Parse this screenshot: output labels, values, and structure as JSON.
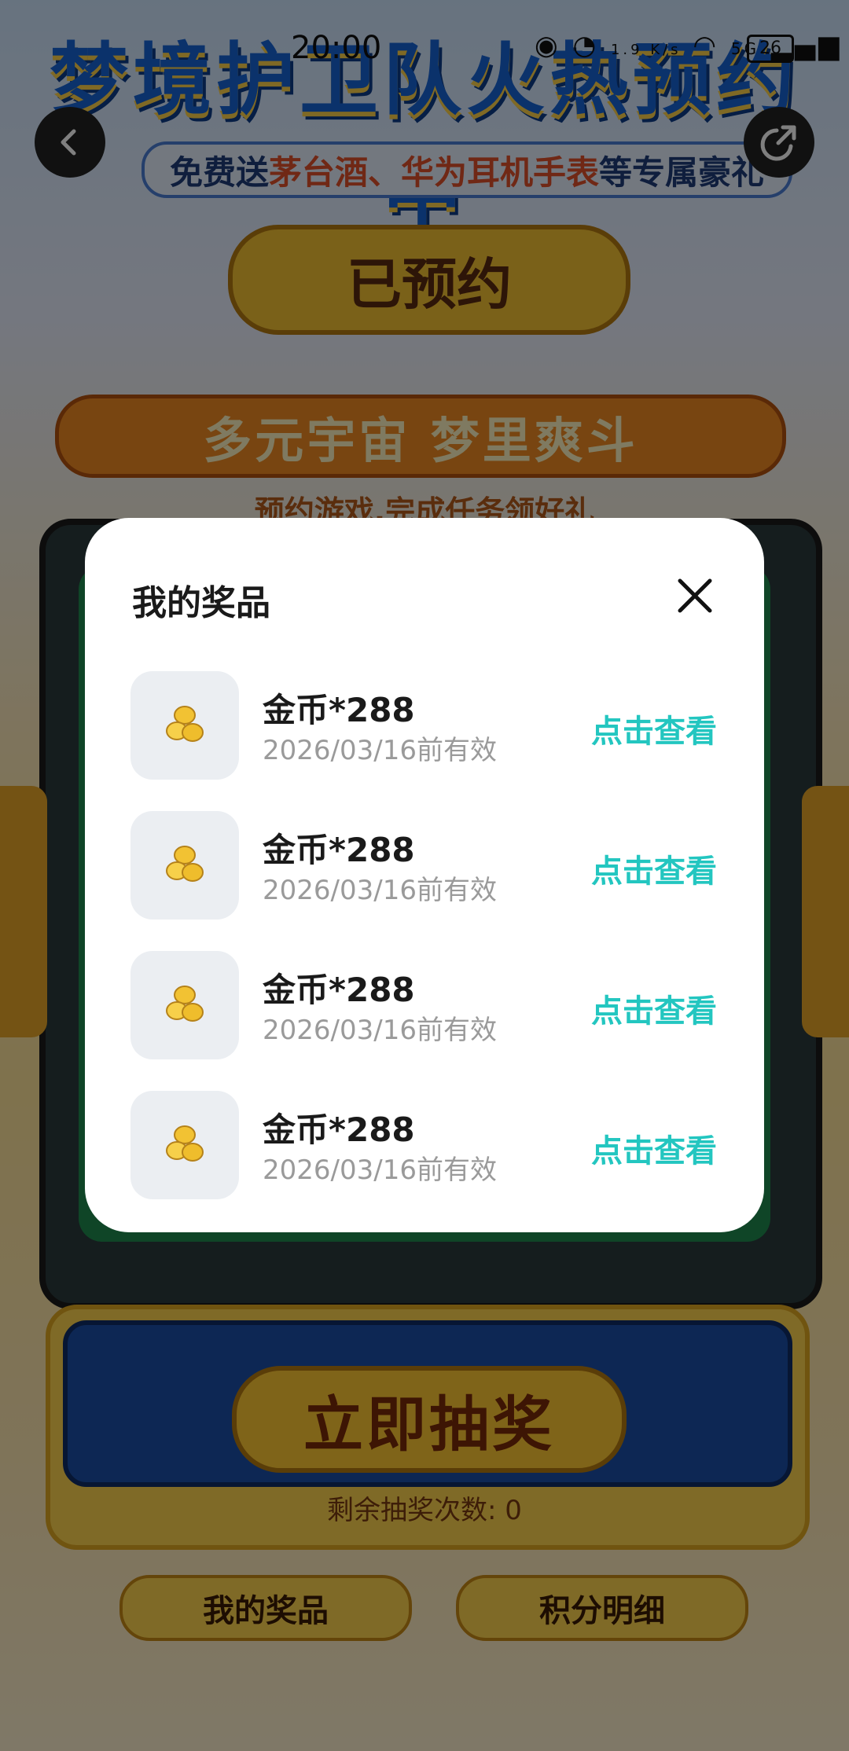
{
  "status_bar": {
    "time": "20:00",
    "network_speed": "1.9 K/s",
    "network_type": "5G",
    "battery": "26"
  },
  "background": {
    "hero_title": "梦境护卫队火热预约中",
    "hero_subtitle_pre": "免费送",
    "hero_subtitle_highlight": "茅台酒、华为耳机手表",
    "hero_subtitle_post": "等专属豪礼",
    "booked_button": "已预约",
    "banner_title": "多元宇宙 梦里爽斗",
    "banner_subtitle": "预约游戏,完成任务领好礼",
    "draw_button": "立即抽奖",
    "remaining_draws": "剩余抽奖次数: 0",
    "my_prizes_button": "我的奖品",
    "points_detail_button": "积分明细"
  },
  "modal": {
    "title": "我的奖品",
    "close_icon": "close-icon",
    "items": [
      {
        "name": "金币*288",
        "expiry": "2026/03/16前有效",
        "action": "点击查看",
        "icon": "gold-coins-icon"
      },
      {
        "name": "金币*288",
        "expiry": "2026/03/16前有效",
        "action": "点击查看",
        "icon": "gold-coins-icon"
      },
      {
        "name": "金币*288",
        "expiry": "2026/03/16前有效",
        "action": "点击查看",
        "icon": "gold-coins-icon"
      },
      {
        "name": "金币*288",
        "expiry": "2026/03/16前有效",
        "action": "点击查看",
        "icon": "gold-coins-icon"
      }
    ]
  },
  "colors": {
    "accent_action": "#23c6c0",
    "overlay": "rgba(0,0,0,0.5)"
  }
}
